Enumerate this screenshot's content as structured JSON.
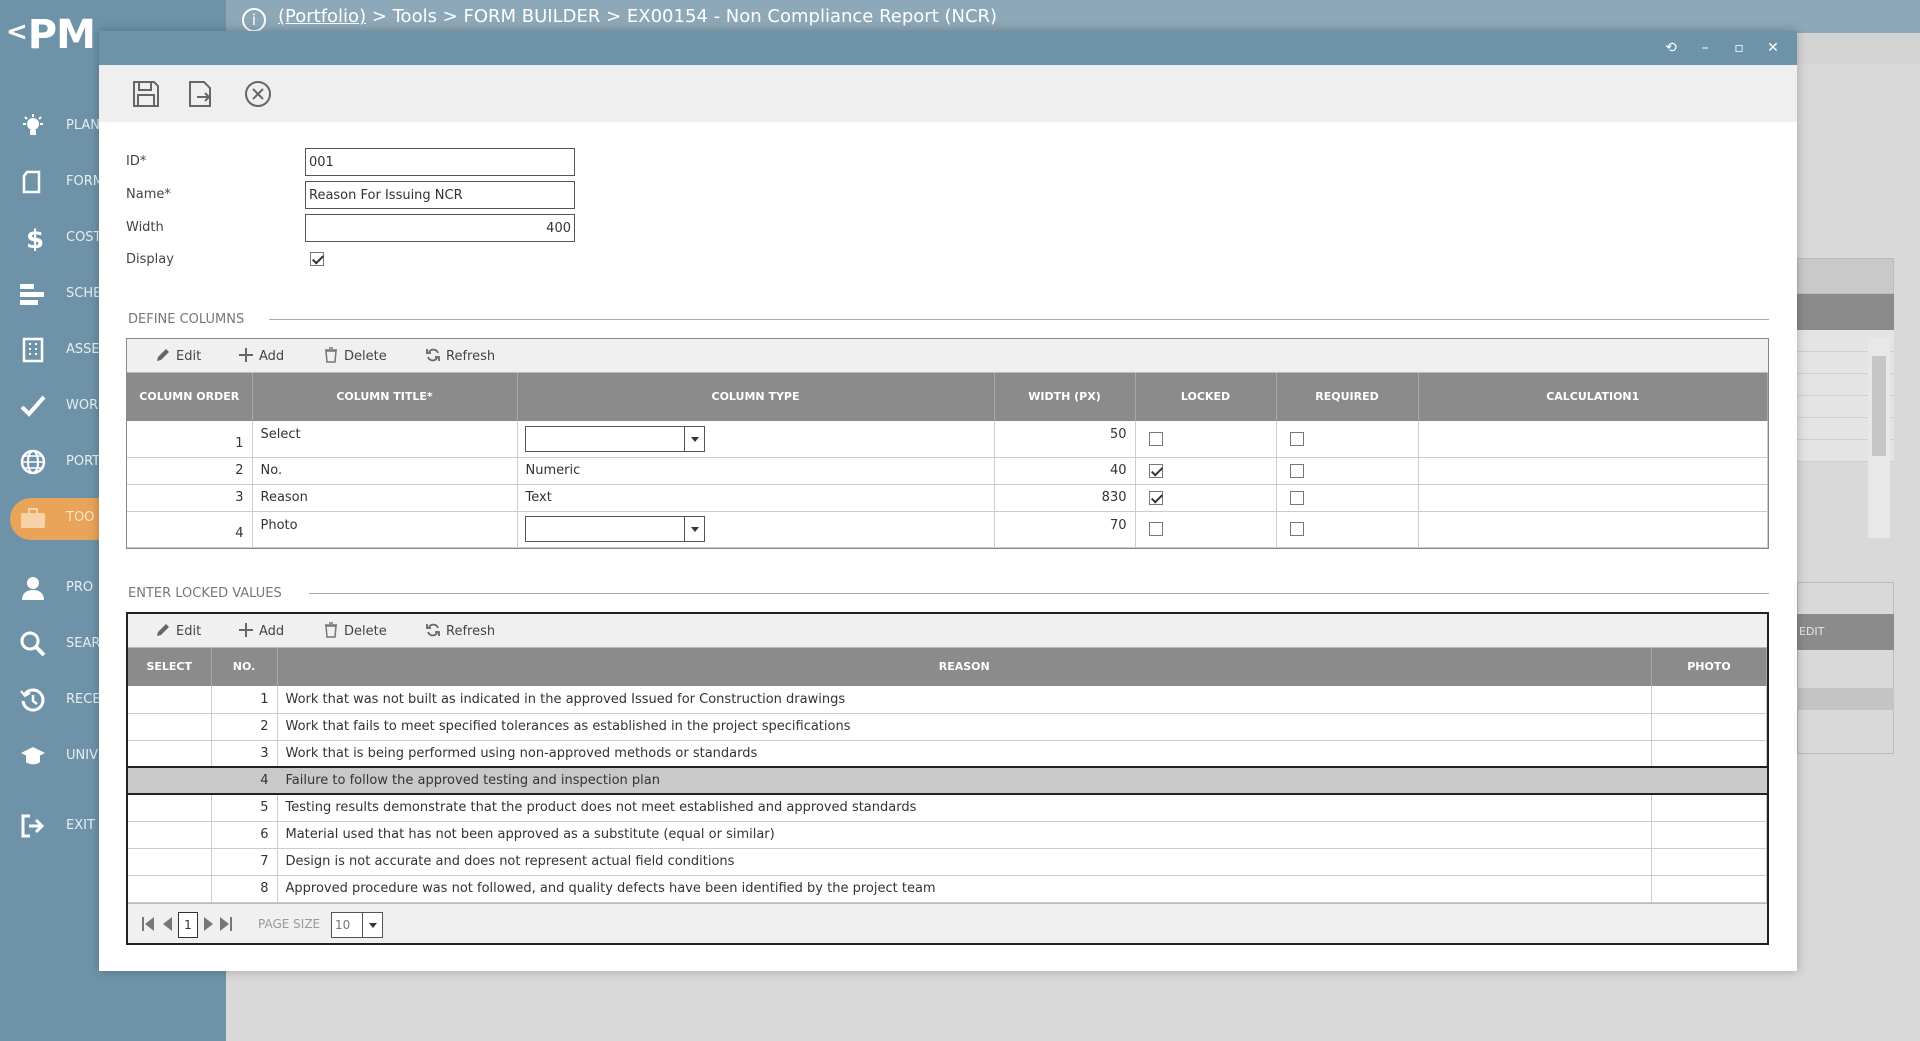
{
  "app": {
    "logo": "PM",
    "breadcrumb": {
      "portfolio_link": "(Portfolio)",
      "rest": " > Tools > FORM BUILDER > EX00154 - Non Compliance Report (NCR)"
    }
  },
  "nav": {
    "items": [
      {
        "label": "PLAN",
        "icon": "lightbulb-icon"
      },
      {
        "label": "FORM",
        "icon": "document-icon"
      },
      {
        "label": "COST",
        "icon": "dollar-icon"
      },
      {
        "label": "SCHE",
        "icon": "schedule-bars-icon"
      },
      {
        "label": "ASSE",
        "icon": "building-icon"
      },
      {
        "label": "WOR",
        "icon": "checkmark-icon"
      },
      {
        "label": "PORT",
        "icon": "globe-icon"
      },
      {
        "label": "TOO",
        "icon": "toolbox-icon"
      },
      {
        "label": "PRO",
        "icon": "person-icon"
      },
      {
        "label": "SEAR",
        "icon": "search-icon"
      },
      {
        "label": "RECE",
        "icon": "history-icon"
      },
      {
        "label": "UNIV",
        "icon": "graduation-cap-icon"
      },
      {
        "label": "EXIT",
        "icon": "exit-icon"
      }
    ]
  },
  "background": {
    "edit_label": "EDIT"
  },
  "form": {
    "id_label": "ID*",
    "id_value": "001",
    "name_label": "Name*",
    "name_value": "Reason For Issuing NCR",
    "width_label": "Width",
    "width_value": "400",
    "display_label": "Display"
  },
  "define_columns": {
    "title": "DEFINE COLUMNS",
    "toolbar": {
      "edit": "Edit",
      "add": "Add",
      "delete": "Delete",
      "refresh": "Refresh"
    },
    "headers": [
      "COLUMN ORDER",
      "COLUMN TITLE*",
      "COLUMN TYPE",
      "WIDTH (PX)",
      "LOCKED",
      "REQUIRED",
      "CALCULATION1"
    ],
    "rows": [
      {
        "order": "1",
        "title": "Select",
        "type": "",
        "width": "50"
      },
      {
        "order": "2",
        "title": "No.",
        "type": "Numeric",
        "width": "40"
      },
      {
        "order": "3",
        "title": "Reason",
        "type": "Text",
        "width": "830"
      },
      {
        "order": "4",
        "title": "Photo",
        "type": "",
        "width": "70"
      }
    ]
  },
  "locked_values": {
    "title": "ENTER LOCKED VALUES",
    "toolbar": {
      "edit": "Edit",
      "add": "Add",
      "delete": "Delete",
      "refresh": "Refresh"
    },
    "headers": [
      "SELECT",
      "NO.",
      "REASON",
      "PHOTO"
    ],
    "rows": [
      {
        "no": "1",
        "reason": "Work that was not built as indicated in the approved Issued for Construction drawings"
      },
      {
        "no": "2",
        "reason": "Work that fails to meet specified tolerances as established in the project specifications"
      },
      {
        "no": "3",
        "reason": "Work that is being performed using non-approved methods or standards"
      },
      {
        "no": "4",
        "reason": "Failure to follow the approved testing and inspection plan"
      },
      {
        "no": "5",
        "reason": "Testing results demonstrate that the product does not meet established and approved standards"
      },
      {
        "no": "6",
        "reason": "Material used that has not been approved as a substitute (equal or similar)"
      },
      {
        "no": "7",
        "reason": "Design is not accurate and does not represent actual field conditions"
      },
      {
        "no": "8",
        "reason": "Approved procedure was not followed, and quality defects have been identified by the project team"
      }
    ],
    "pager": {
      "page": "1",
      "page_size_label": "PAGE SIZE",
      "page_size": "10"
    }
  }
}
